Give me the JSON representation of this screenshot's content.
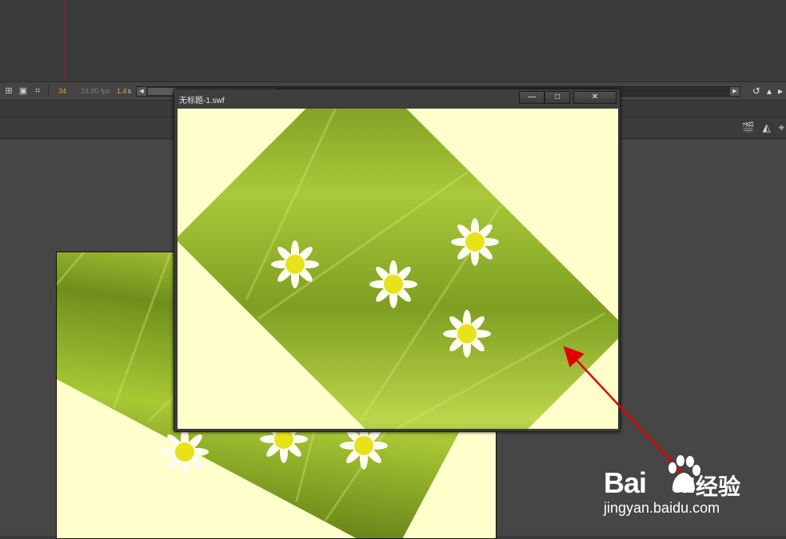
{
  "timeline": {
    "current_frame": "34",
    "fps": "24.00 fps",
    "time_value": "1.4",
    "time_unit": "s"
  },
  "swf_window": {
    "title": "无标题-1.swf",
    "minimize_glyph": "—",
    "maximize_glyph": "□",
    "close_glyph": "✕"
  },
  "watermark": {
    "brand": "Bai",
    "brand_suffix": "u",
    "product": "经验",
    "url": "jingyan.baidu.com"
  },
  "colors": {
    "stage_bg": "#ffffcc",
    "arrow": "#e00000",
    "frame_number": "#e2a22b"
  }
}
